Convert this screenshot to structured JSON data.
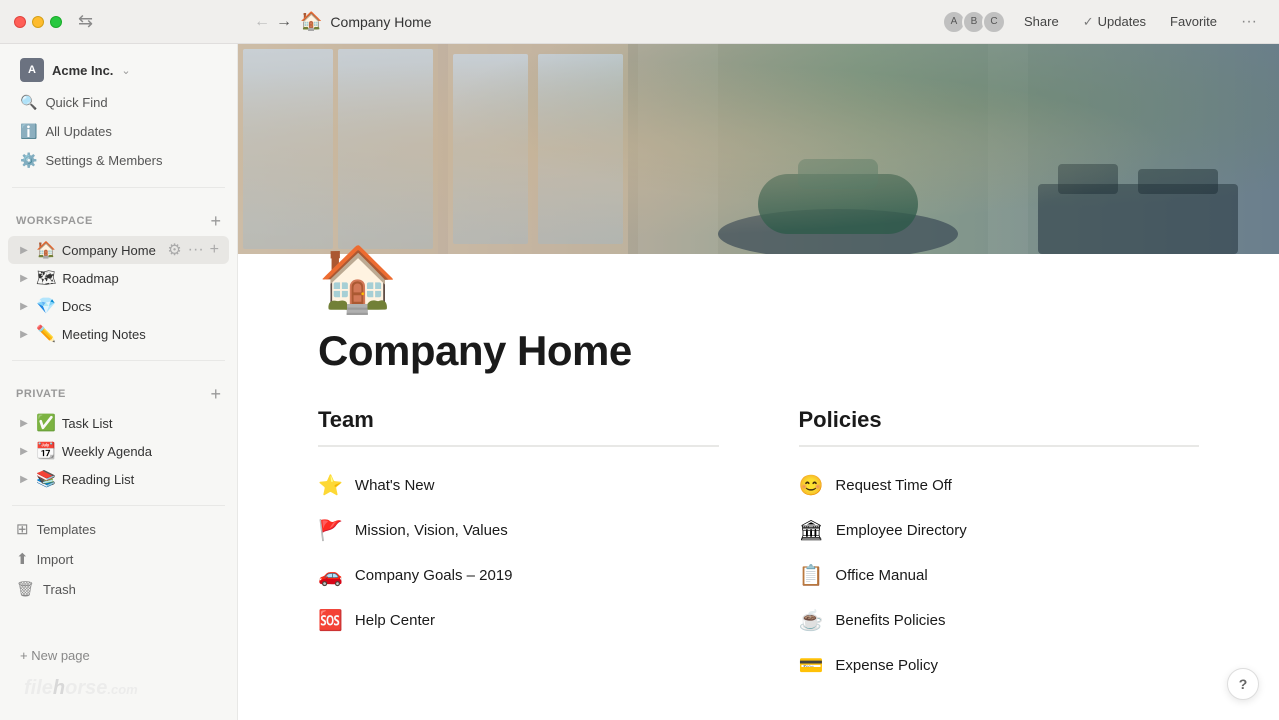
{
  "titlebar": {
    "page_title": "Company Home",
    "page_icon": "🏠",
    "back_arrow": "←",
    "forward_arrow": "→",
    "share_label": "Share",
    "updates_label": "Updates",
    "favorite_label": "Favorite",
    "more_label": "···"
  },
  "sidebar": {
    "workspace_name": "Acme Inc.",
    "workspace_chevron": "⌄",
    "nav_items": [
      {
        "id": "quick-find",
        "icon": "🔍",
        "label": "Quick Find"
      },
      {
        "id": "all-updates",
        "icon": "ℹ",
        "label": "All Updates"
      },
      {
        "id": "settings",
        "icon": "⚙",
        "label": "Settings & Members"
      }
    ],
    "workspace_section_label": "WORKSPACE",
    "workspace_items": [
      {
        "id": "company-home",
        "emoji": "🏠",
        "label": "Company Home",
        "active": true
      },
      {
        "id": "roadmap",
        "emoji": "🗺",
        "label": "Roadmap"
      },
      {
        "id": "docs",
        "emoji": "💎",
        "label": "Docs"
      },
      {
        "id": "meeting-notes",
        "emoji": "✏",
        "label": "Meeting Notes"
      }
    ],
    "private_section_label": "PRIVATE",
    "private_items": [
      {
        "id": "task-list",
        "emoji": "✅",
        "label": "Task List"
      },
      {
        "id": "weekly-agenda",
        "emoji": "📆",
        "label": "Weekly Agenda"
      },
      {
        "id": "reading-list",
        "emoji": "📚",
        "label": "Reading List"
      }
    ],
    "bottom_items": [
      {
        "id": "templates",
        "icon": "⊞",
        "label": "Templates"
      },
      {
        "id": "import",
        "icon": "↑",
        "label": "Import"
      },
      {
        "id": "trash",
        "icon": "🗑",
        "label": "Trash"
      }
    ],
    "new_page_label": "+ New page",
    "filehorse_text": "filehorse.com"
  },
  "main": {
    "page_icon": "🏠",
    "page_title": "Company Home",
    "team_section": {
      "header": "Team",
      "items": [
        {
          "emoji": "⭐",
          "label": "What's New"
        },
        {
          "emoji": "🚩",
          "label": "Mission, Vision, Values"
        },
        {
          "emoji": "🚗",
          "label": "Company Goals – 2019"
        },
        {
          "emoji": "🆘",
          "label": "Help Center"
        }
      ]
    },
    "policies_section": {
      "header": "Policies",
      "items": [
        {
          "emoji": "😊",
          "label": "Request Time Off"
        },
        {
          "emoji": "🏛",
          "label": "Employee Directory"
        },
        {
          "emoji": "📋",
          "label": "Office Manual"
        },
        {
          "emoji": "☕",
          "label": "Benefits Policies"
        },
        {
          "emoji": "💳",
          "label": "Expense Policy"
        }
      ]
    }
  },
  "help_btn": "?"
}
